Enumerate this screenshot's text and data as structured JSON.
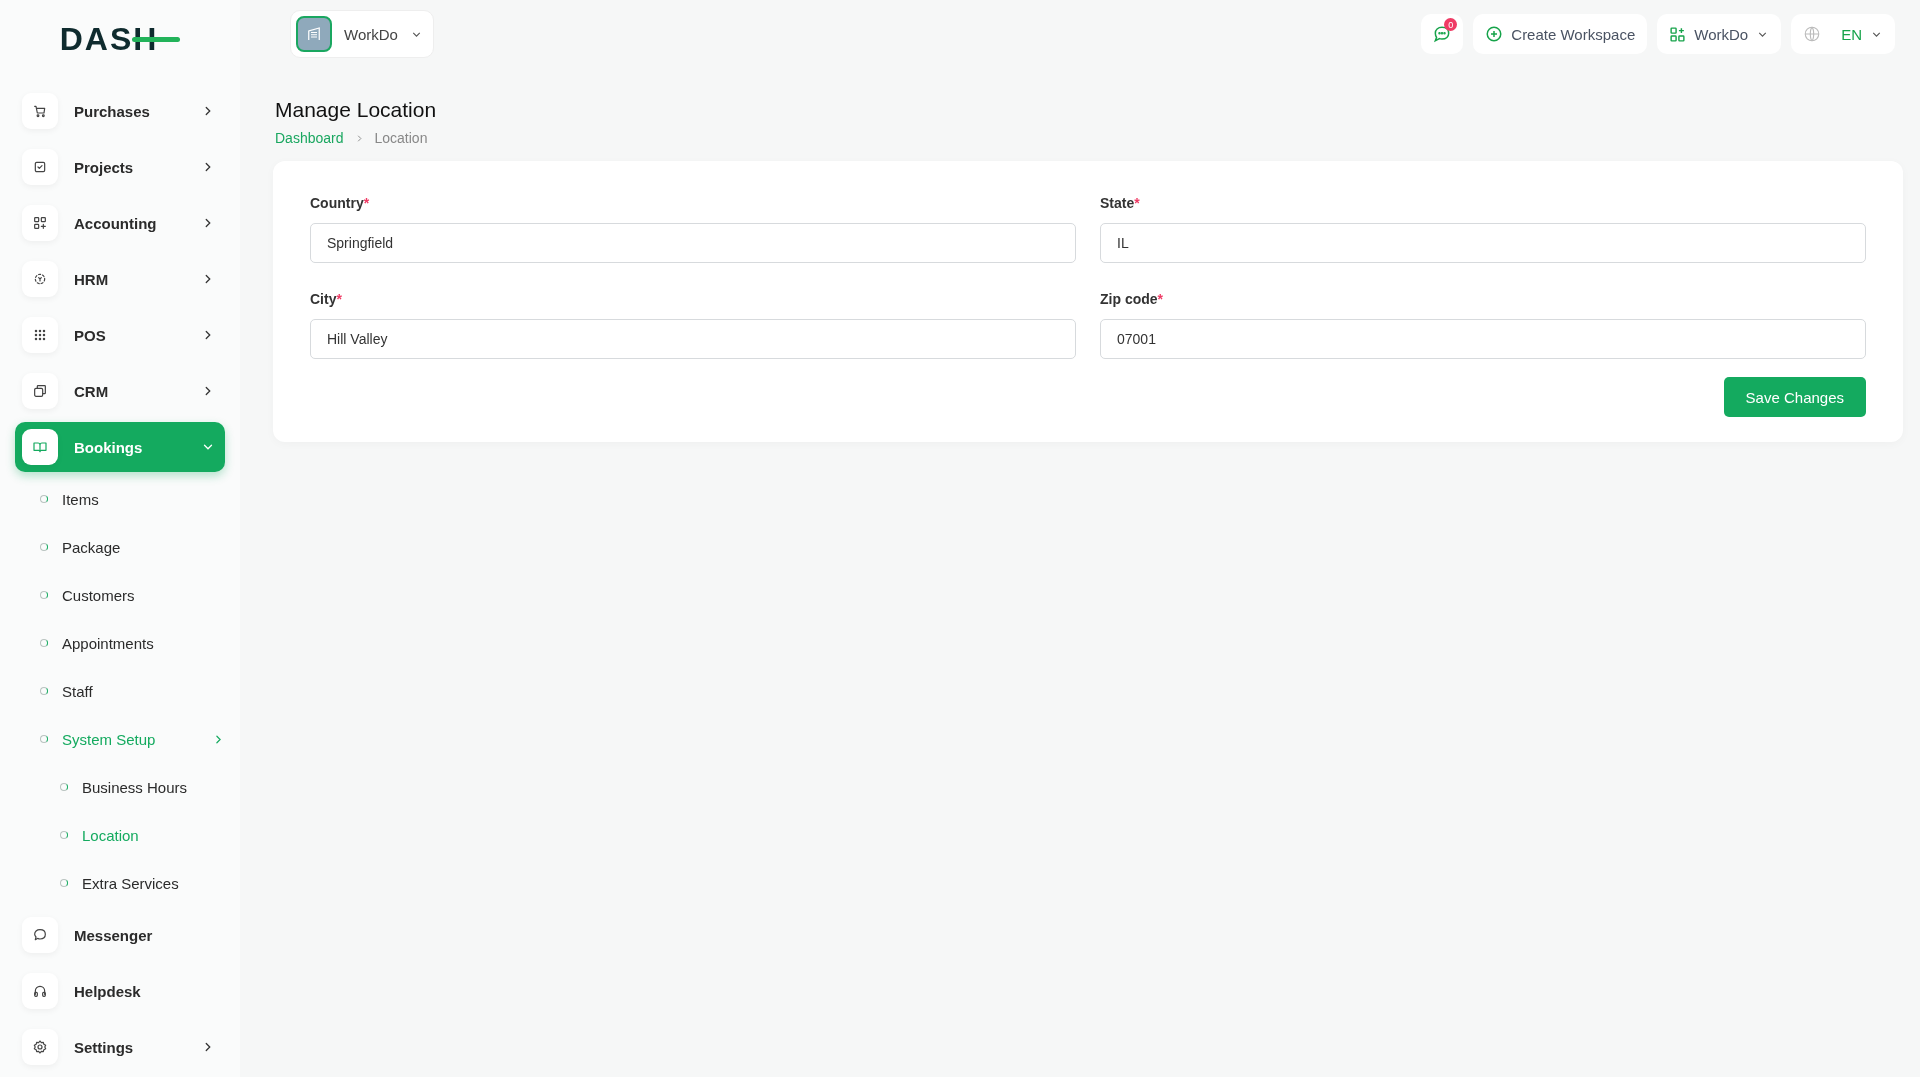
{
  "logo": {
    "text": "DASH"
  },
  "workspace_switcher": {
    "label": "WorkDo"
  },
  "header_actions": {
    "notification_count": "0",
    "create_workspace": "Create Workspace",
    "workspace": "WorkDo",
    "language": "EN"
  },
  "sidebar": {
    "items": [
      {
        "label": "Purchases",
        "kind": "group",
        "selected": false,
        "expanded": false
      },
      {
        "label": "Projects",
        "kind": "group",
        "selected": false,
        "expanded": false
      },
      {
        "label": "Accounting",
        "kind": "group",
        "selected": false,
        "expanded": false
      },
      {
        "label": "HRM",
        "kind": "group",
        "selected": false,
        "expanded": false
      },
      {
        "label": "POS",
        "kind": "group",
        "selected": false,
        "expanded": false
      },
      {
        "label": "CRM",
        "kind": "group",
        "selected": false,
        "expanded": false
      },
      {
        "label": "Bookings",
        "kind": "group",
        "selected": true,
        "expanded": true,
        "children": [
          {
            "label": "Items",
            "kind": "link",
            "selected": false
          },
          {
            "label": "Package",
            "kind": "link",
            "selected": false
          },
          {
            "label": "Customers",
            "kind": "link",
            "selected": false
          },
          {
            "label": "Appointments",
            "kind": "link",
            "selected": false
          },
          {
            "label": "Staff",
            "kind": "link",
            "selected": false
          },
          {
            "label": "System Setup",
            "kind": "group",
            "selected": true,
            "expanded": false,
            "children": [
              {
                "label": "Business Hours",
                "selected": false
              },
              {
                "label": "Location",
                "selected": true
              },
              {
                "label": "Extra Services",
                "selected": false
              }
            ]
          }
        ]
      },
      {
        "label": "Messenger",
        "kind": "link",
        "selected": false
      },
      {
        "label": "Helpdesk",
        "kind": "link",
        "selected": false
      },
      {
        "label": "Settings",
        "kind": "group",
        "selected": false,
        "expanded": false
      }
    ]
  },
  "page": {
    "title": "Manage Location",
    "breadcrumb": [
      {
        "label": "Dashboard",
        "selected": false
      },
      {
        "label": "Location",
        "selected": true
      }
    ]
  },
  "form": {
    "fields": [
      {
        "label": "Country",
        "required_mark": "*",
        "value": "Springfield"
      },
      {
        "label": "State",
        "required_mark": "*",
        "value": "IL"
      },
      {
        "label": "City",
        "required_mark": "*",
        "value": "Hill Valley"
      },
      {
        "label": "Zip code",
        "required_mark": "*",
        "value": "07001"
      }
    ],
    "submit": "Save Changes"
  }
}
